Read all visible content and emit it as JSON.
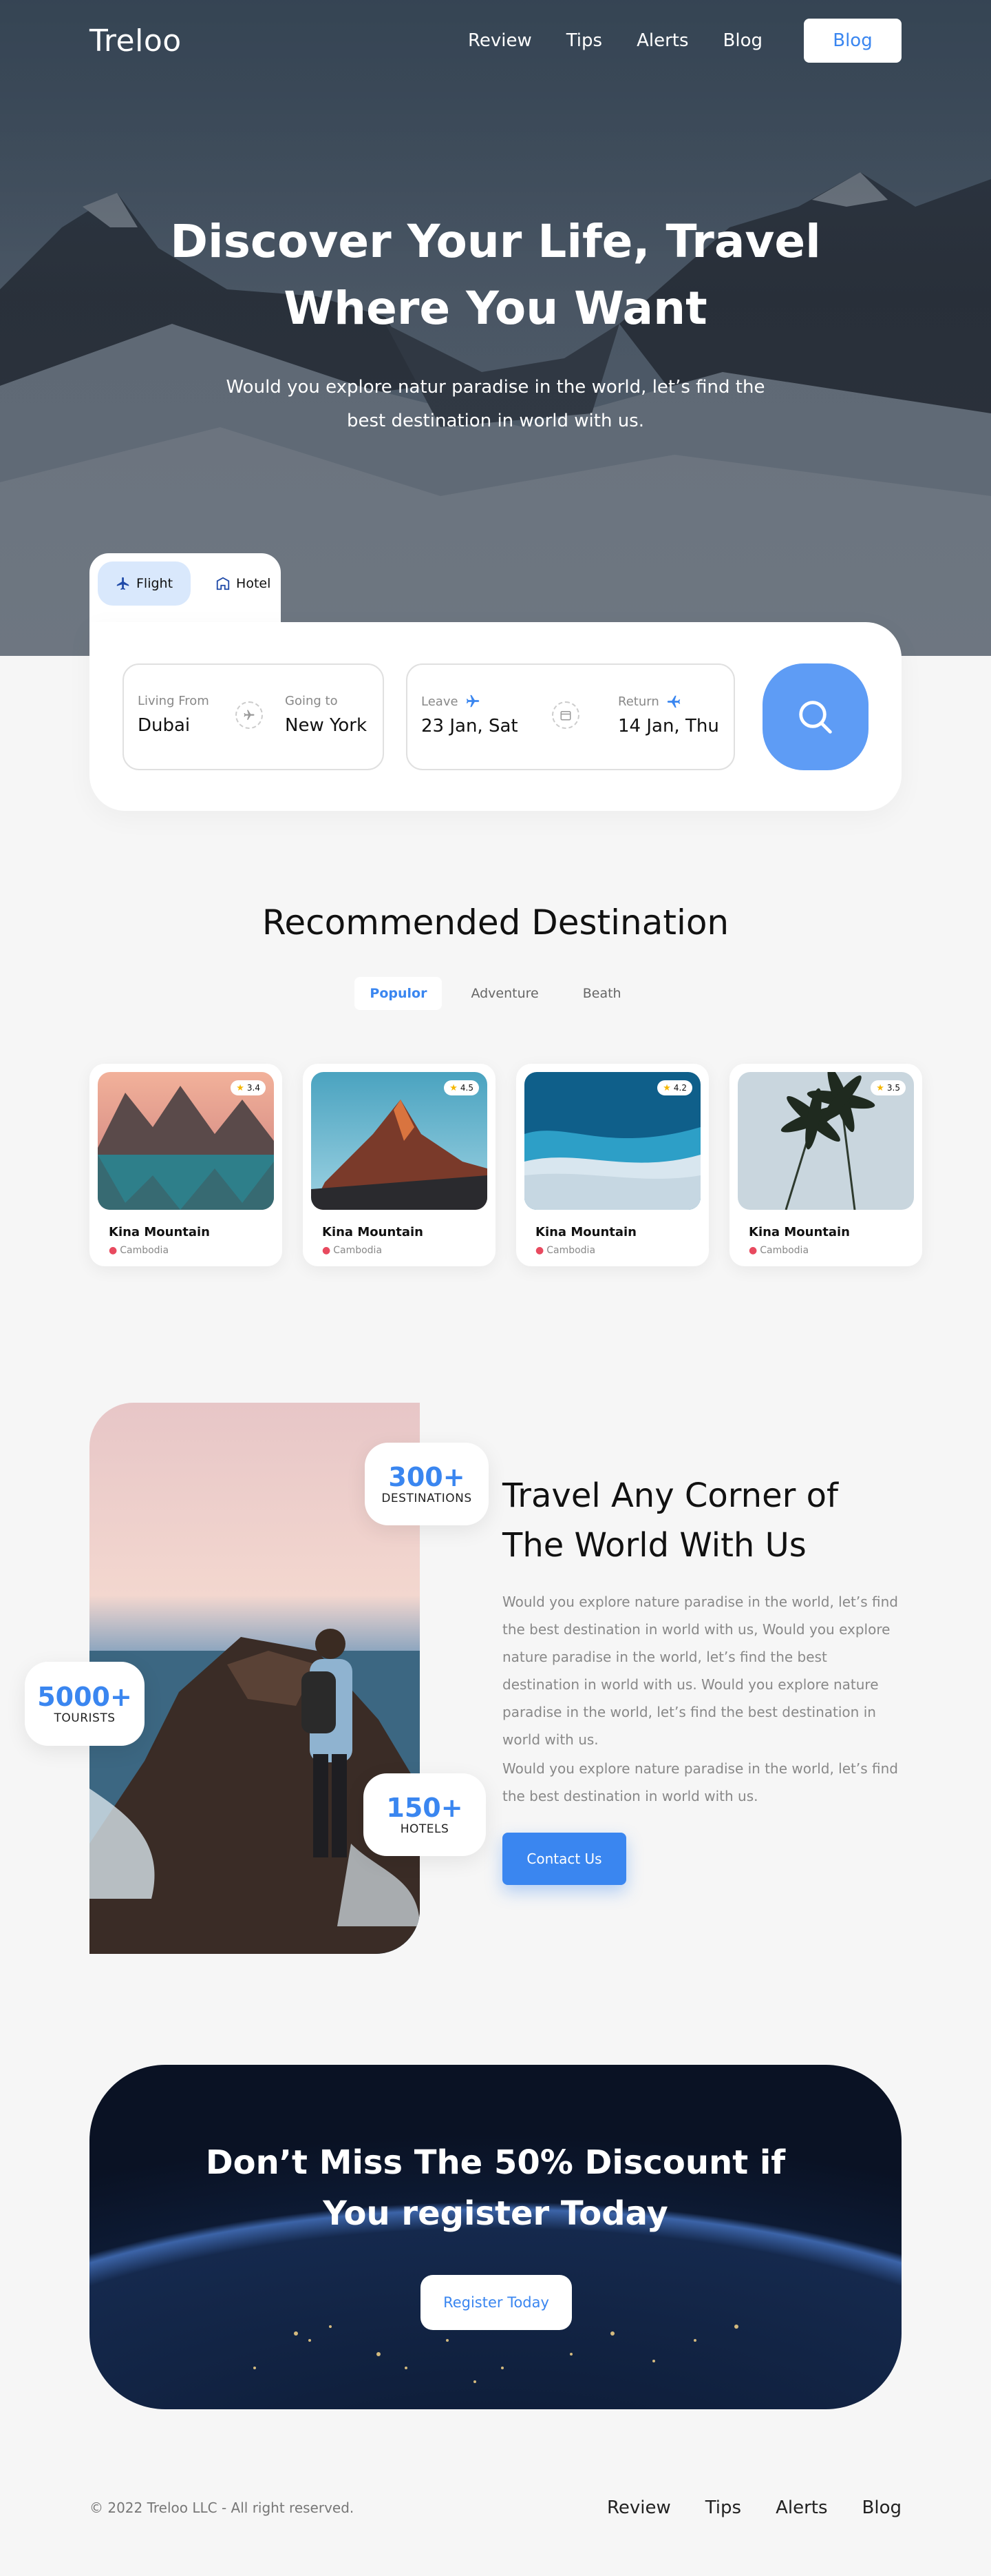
{
  "brand": "Treloo",
  "nav": {
    "links": [
      "Review",
      "Tips",
      "Alerts",
      "Blog"
    ],
    "cta": "Blog"
  },
  "hero": {
    "title_line1": "Discover Your Life, Travel",
    "title_line2": "Where You Want",
    "subtitle": "Would you explore natur paradise in the world, let’s find the best destination in world with us."
  },
  "search": {
    "tabs": [
      {
        "label": "Flight",
        "icon": "airplane-icon"
      },
      {
        "label": "Hotel",
        "icon": "hotel-icon"
      }
    ],
    "from_label": "Living From",
    "from_value": "Dubai",
    "to_label": "Going to",
    "to_value": "New York",
    "leave_label": "Leave",
    "leave_value": "23 Jan, Sat",
    "return_label": "Return",
    "return_value": "14 Jan, Thu"
  },
  "recommended": {
    "title": "Recommended Destination",
    "filters": [
      "Populor",
      "Adventure",
      "Beath"
    ],
    "cards": [
      {
        "name": "Kina Mountain",
        "location": "Cambodia",
        "rating": "3.4"
      },
      {
        "name": "Kina Mountain",
        "location": "Cambodia",
        "rating": "4.5"
      },
      {
        "name": "Kina Mountain",
        "location": "Cambodia",
        "rating": "4.2"
      },
      {
        "name": "Kina Mountain",
        "location": "Cambodia",
        "rating": "3.5"
      }
    ]
  },
  "about": {
    "stats": [
      {
        "num": "300+",
        "label": "DESTINATIONS"
      },
      {
        "num": "5000+",
        "label": "TOURISTS"
      },
      {
        "num": "150+",
        "label": "HOTELS"
      }
    ],
    "title_line1": "Travel Any Corner of",
    "title_line2": "The World With Us",
    "para1": "Would you explore nature paradise in the world, let’s find the best destination in world with us, Would you explore nature paradise in the world, let’s find the best destination in world with us. Would you explore nature paradise in the world, let’s find the best destination in world with us.",
    "para2": "Would you explore nature paradise in the world, let’s find the best destination in world with us.",
    "cta": "Contact Us"
  },
  "promo": {
    "title_line1": "Don’t Miss The 50% Discount if",
    "title_line2": "You register Today",
    "cta": "Register Today"
  },
  "footer": {
    "copyright": "© 2022 Treloo LLC - All right reserved.",
    "links": [
      "Review",
      "Tips",
      "Alerts",
      "Blog"
    ]
  },
  "colors": {
    "accent": "#3a86f0",
    "search_button": "#5e9cf5",
    "background": "#f6f6f6"
  }
}
